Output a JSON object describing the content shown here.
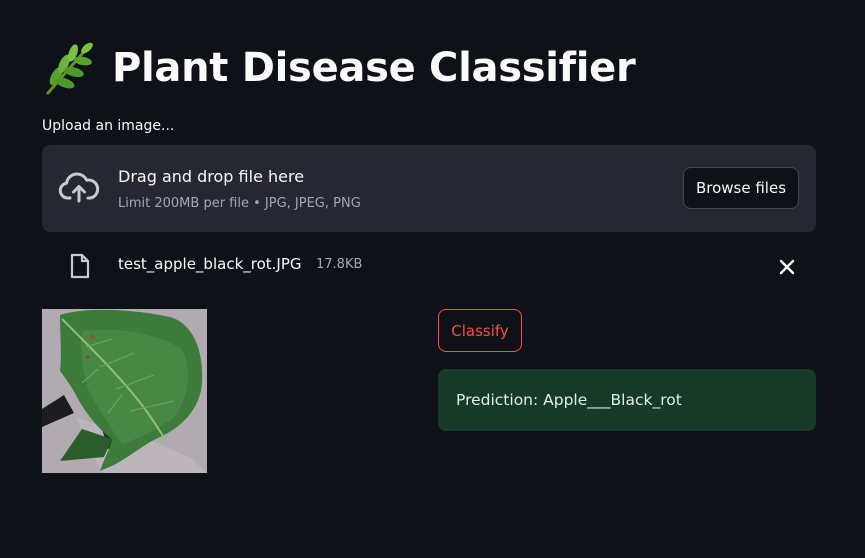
{
  "app": {
    "title": "Plant Disease Classifier",
    "title_icon": "herb-icon"
  },
  "uploader": {
    "label": "Upload an image...",
    "drop_text": "Drag and drop file here",
    "limit_text": "Limit 200MB per file • JPG, JPEG, PNG",
    "browse_label": "Browse files",
    "icon": "cloud-upload-icon"
  },
  "file": {
    "name": "test_apple_black_rot.JPG",
    "size": "17.8KB",
    "icon": "file-icon",
    "remove_icon": "close-icon"
  },
  "image": {
    "content": "apple-leaf-photo"
  },
  "actions": {
    "classify_label": "Classify"
  },
  "result": {
    "text": "Prediction: Apple___Black_rot"
  },
  "colors": {
    "background": "#0e1117",
    "dropzone": "#262730",
    "accent": "#ff4b4b",
    "success_bg": "#173928",
    "muted_text": "#a3a8b8"
  }
}
